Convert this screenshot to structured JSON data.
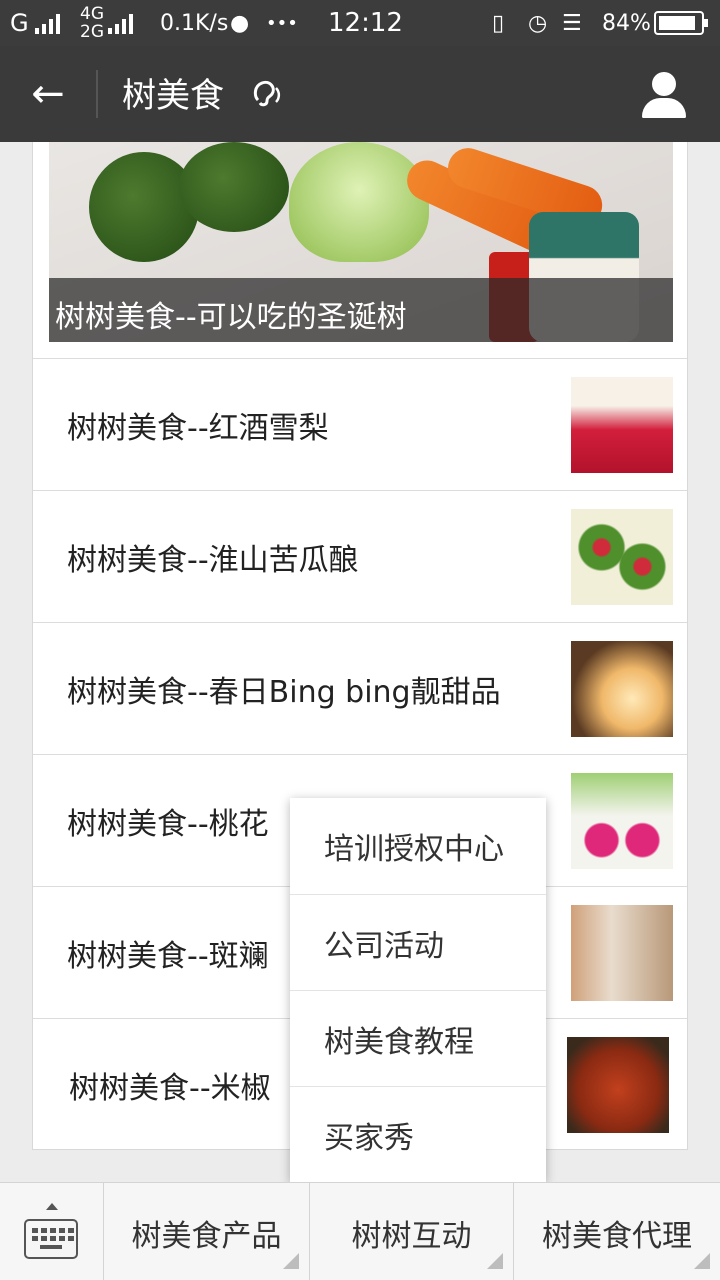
{
  "status_bar": {
    "carrier_g": "G",
    "net_4g": "4G",
    "net_2g": "2G",
    "speed": "0.1K/s",
    "more": "•••",
    "time": "12:12",
    "battery": "84%"
  },
  "header": {
    "back_icon": "←",
    "title": "树美食",
    "ear_icon": "e͡"
  },
  "hero": {
    "caption": "树树美食--可以吃的圣诞树"
  },
  "articles": [
    {
      "title": "树树美食--红酒雪梨"
    },
    {
      "title": "树树美食--淮山苦瓜酿"
    },
    {
      "title": "树树美食--春日Bing bing靓甜品"
    },
    {
      "title": "树树美食--桃花"
    },
    {
      "title": "树树美食--斑斓"
    },
    {
      "title": "树树美食--米椒"
    }
  ],
  "popup_menu": {
    "items": [
      "培训授权中心",
      "公司活动",
      "树美食教程",
      "买家秀"
    ]
  },
  "bottom_menu": {
    "items": [
      "树美食产品",
      "树树互动",
      "树美食代理"
    ]
  },
  "colors": {
    "header_bg": "#3a3a3a",
    "page_bg": "#ececec",
    "card_bg": "#ffffff"
  }
}
